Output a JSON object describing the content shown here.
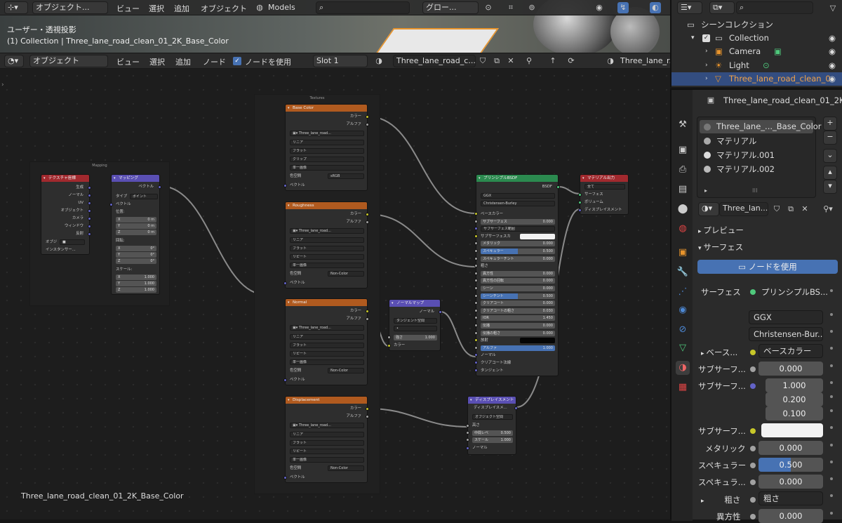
{
  "viewport": {
    "mode_label": "オブジェクト...",
    "menu": [
      "ビュー",
      "選択",
      "追加",
      "オブジェクト"
    ],
    "models_label": "Models",
    "transform_label": "グロー...",
    "title": "ユーザー・透視投影",
    "subtitle": "(1) Collection | Three_lane_road_clean_01_2K_Base_Color"
  },
  "node_header": {
    "mode_label": "オブジェクト",
    "menu": [
      "ビュー",
      "選択",
      "追加",
      "ノード"
    ],
    "use_nodes_label": "ノードを使用",
    "slot_label": "Slot 1",
    "material_name": "Three_lane_road_c...",
    "right_name": "Three_lane_r..."
  },
  "editor": {
    "footer_label": "Three_lane_road_clean_01_2K_Base_Color"
  },
  "frames": {
    "mapping": "Mapping",
    "textures": "Textures"
  },
  "texcoord": {
    "title": "テクスチャ座標",
    "outputs": [
      "生成",
      "ノーマル",
      "UV",
      "オブジェクト",
      "カメラ",
      "ウィンドウ",
      "反射"
    ],
    "object_label": "オブジ",
    "instancer_label": "インスタンサー..."
  },
  "mapping": {
    "title": "マッピング",
    "out": "ベクトル",
    "type_label": "タイプ",
    "type_value": "ポイント",
    "in_vector": "ベクトル",
    "loc": "位置:",
    "rot": "回転:",
    "scale": "スケール:",
    "x": "X",
    "y": "Y",
    "z": "Z",
    "loc_vals": [
      "0 m",
      "0 m",
      "0 m"
    ],
    "rot_vals": [
      "0°",
      "0°",
      "0°"
    ],
    "scale_vals": [
      "1.000",
      "1.000",
      "1.000"
    ]
  },
  "tex_common": {
    "color": "カラー",
    "alpha": "アルファ",
    "img": "Three_lane_road...",
    "interp": "リニア",
    "proj": "フラット",
    "single": "単一画像",
    "cs": "色空間",
    "vector": "ベクトル"
  },
  "tex_nodes": [
    {
      "title": "Base Color",
      "ext": "クリップ",
      "cs_val": "sRGB"
    },
    {
      "title": "Roughness",
      "ext": "リピート",
      "cs_val": "Non-Color"
    },
    {
      "title": "Normal",
      "ext": "リピート",
      "cs_val": "Non-Color"
    },
    {
      "title": "Displacement",
      "ext": "リピート",
      "cs_val": "Non-Color"
    }
  ],
  "normalmap": {
    "title": "ノーマルマップ",
    "out": "ノーマル",
    "space": "タンジェント空間",
    "strength": "強さ",
    "strength_val": "1.000",
    "color": "カラー"
  },
  "bsdf": {
    "title": "プリンシプルBSDF",
    "out": "BSDF",
    "dist": "GGX",
    "sss": "Christensen-Burley",
    "rows": [
      [
        "ベースカラー",
        ""
      ],
      [
        "サブサーフェス",
        "0.000"
      ],
      [
        "サブサーフェス範囲",
        ""
      ],
      [
        "サブサーフェスカ",
        ""
      ],
      [
        "メタリック",
        "0.000"
      ],
      [
        "スペキュラー",
        "0.500"
      ],
      [
        "スペキュラーチント",
        "0.000"
      ],
      [
        "粗さ",
        ""
      ],
      [
        "異方性",
        "0.000"
      ],
      [
        "異方性の回転",
        "0.000"
      ],
      [
        "シーン",
        "0.000"
      ],
      [
        "シーンチント",
        "0.500"
      ],
      [
        "クリアコート",
        "0.000"
      ],
      [
        "クリアコートの粗さ",
        "0.030"
      ],
      [
        "IOR",
        "1.450"
      ],
      [
        "伝播",
        "0.000"
      ],
      [
        "伝播の粗さ",
        "0.000"
      ],
      [
        "放射",
        ""
      ],
      [
        "アルファ",
        "1.000"
      ],
      [
        "ノーマル",
        ""
      ],
      [
        "クリアコート法線",
        ""
      ],
      [
        "タンジェント",
        ""
      ]
    ]
  },
  "output": {
    "title": "マテリアル出力",
    "target": "全て",
    "inputs": [
      "サーフェス",
      "ボリューム",
      "ディスプレイスメント"
    ]
  },
  "disp": {
    "title": "ディスプレイスメント",
    "out": "ディスプレイスメ...",
    "space": "オブジェクト空間",
    "height": "高さ",
    "mid": "中間レベ",
    "mid_val": "0.500",
    "scale": "スケール",
    "scale_val": "1.000",
    "normal": "ノーマル"
  },
  "outliner": {
    "title": "シーンコレクション",
    "items": [
      "Collection",
      "Camera",
      "Light",
      "Three_lane_road_clean_0"
    ]
  },
  "props": {
    "object_name": "Three_lane_road_clean_01_2K_B",
    "slots": [
      "Three_lane_..._Base_Color",
      "マテリアル",
      "マテリアル.001",
      "マテリアル.002"
    ],
    "mat_field": "Three_lan...",
    "preview": "プレビュー",
    "surface_section": "サーフェス",
    "use_nodes": "ノードを使用",
    "surface_label": "サーフェス",
    "surface_value": "プリンシプルBS...",
    "dist": "GGX",
    "sss_method": "Christensen-Bur...",
    "base_label": "ベース...",
    "base_value": "ベースカラー",
    "sub_label": "サブサーフ...",
    "sub_val": "0.000",
    "subr_label": "サブサーフ...",
    "subr_vals": [
      "1.000",
      "0.200",
      "0.100"
    ],
    "subc_label": "サブサーフ...",
    "metal_label": "メタリック",
    "metal_val": "0.000",
    "spec_label": "スペキュラー",
    "spec_val": "0.500",
    "spect_label": "スペキュラ...",
    "spect_val": "0.000",
    "rough_label": "粗さ",
    "rough_value": "粗さ",
    "aniso_label": "異方性",
    "aniso_val": "0.000",
    "spec_fraction": 0.5
  },
  "colors": {
    "accent": "#4772b3",
    "tex_header": "#b05a1f",
    "bsdf_header": "#2b8a4f",
    "vector_header": "#5a4fb3",
    "output_header": "#a1292e",
    "input_header": "#a1292e"
  }
}
